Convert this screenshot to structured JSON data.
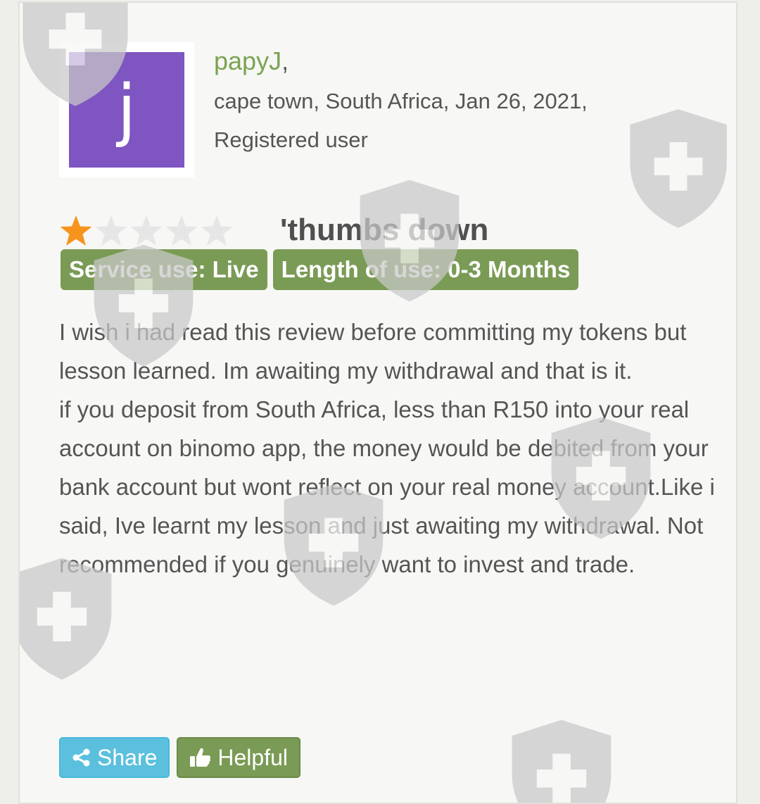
{
  "author": {
    "name": "papyJ",
    "avatar_letter": "j",
    "avatar_color": "#7e55c1"
  },
  "meta": {
    "location_date": "cape town, South Africa, Jan 26, 2021,",
    "user_type": "Registered user"
  },
  "rating": {
    "value": 1,
    "max": 5,
    "filled_color": "#f7941d",
    "empty_color": "#e6e6e6"
  },
  "review": {
    "title": "'thumbs down",
    "tags": [
      "Service use: Live",
      "Length of use: 0-3 Months"
    ],
    "paragraphs": [
      "I wish i had read this review before committing my tokens but lesson learned. Im awaiting my withdrawal and that is it.",
      "if you deposit from South Africa, less than R150 into your real account on binomo app, the money would be debited from your bank account but wont reflect on your real money account.Like i said, Ive learnt my lesson and just awaiting my withdrawal. Not recommended if you genuinely want to invest and trade."
    ]
  },
  "actions": {
    "share_label": "Share",
    "helpful_label": "Helpful"
  },
  "colors": {
    "accent_green": "#7a9b55",
    "share_blue": "#5bc0de"
  }
}
